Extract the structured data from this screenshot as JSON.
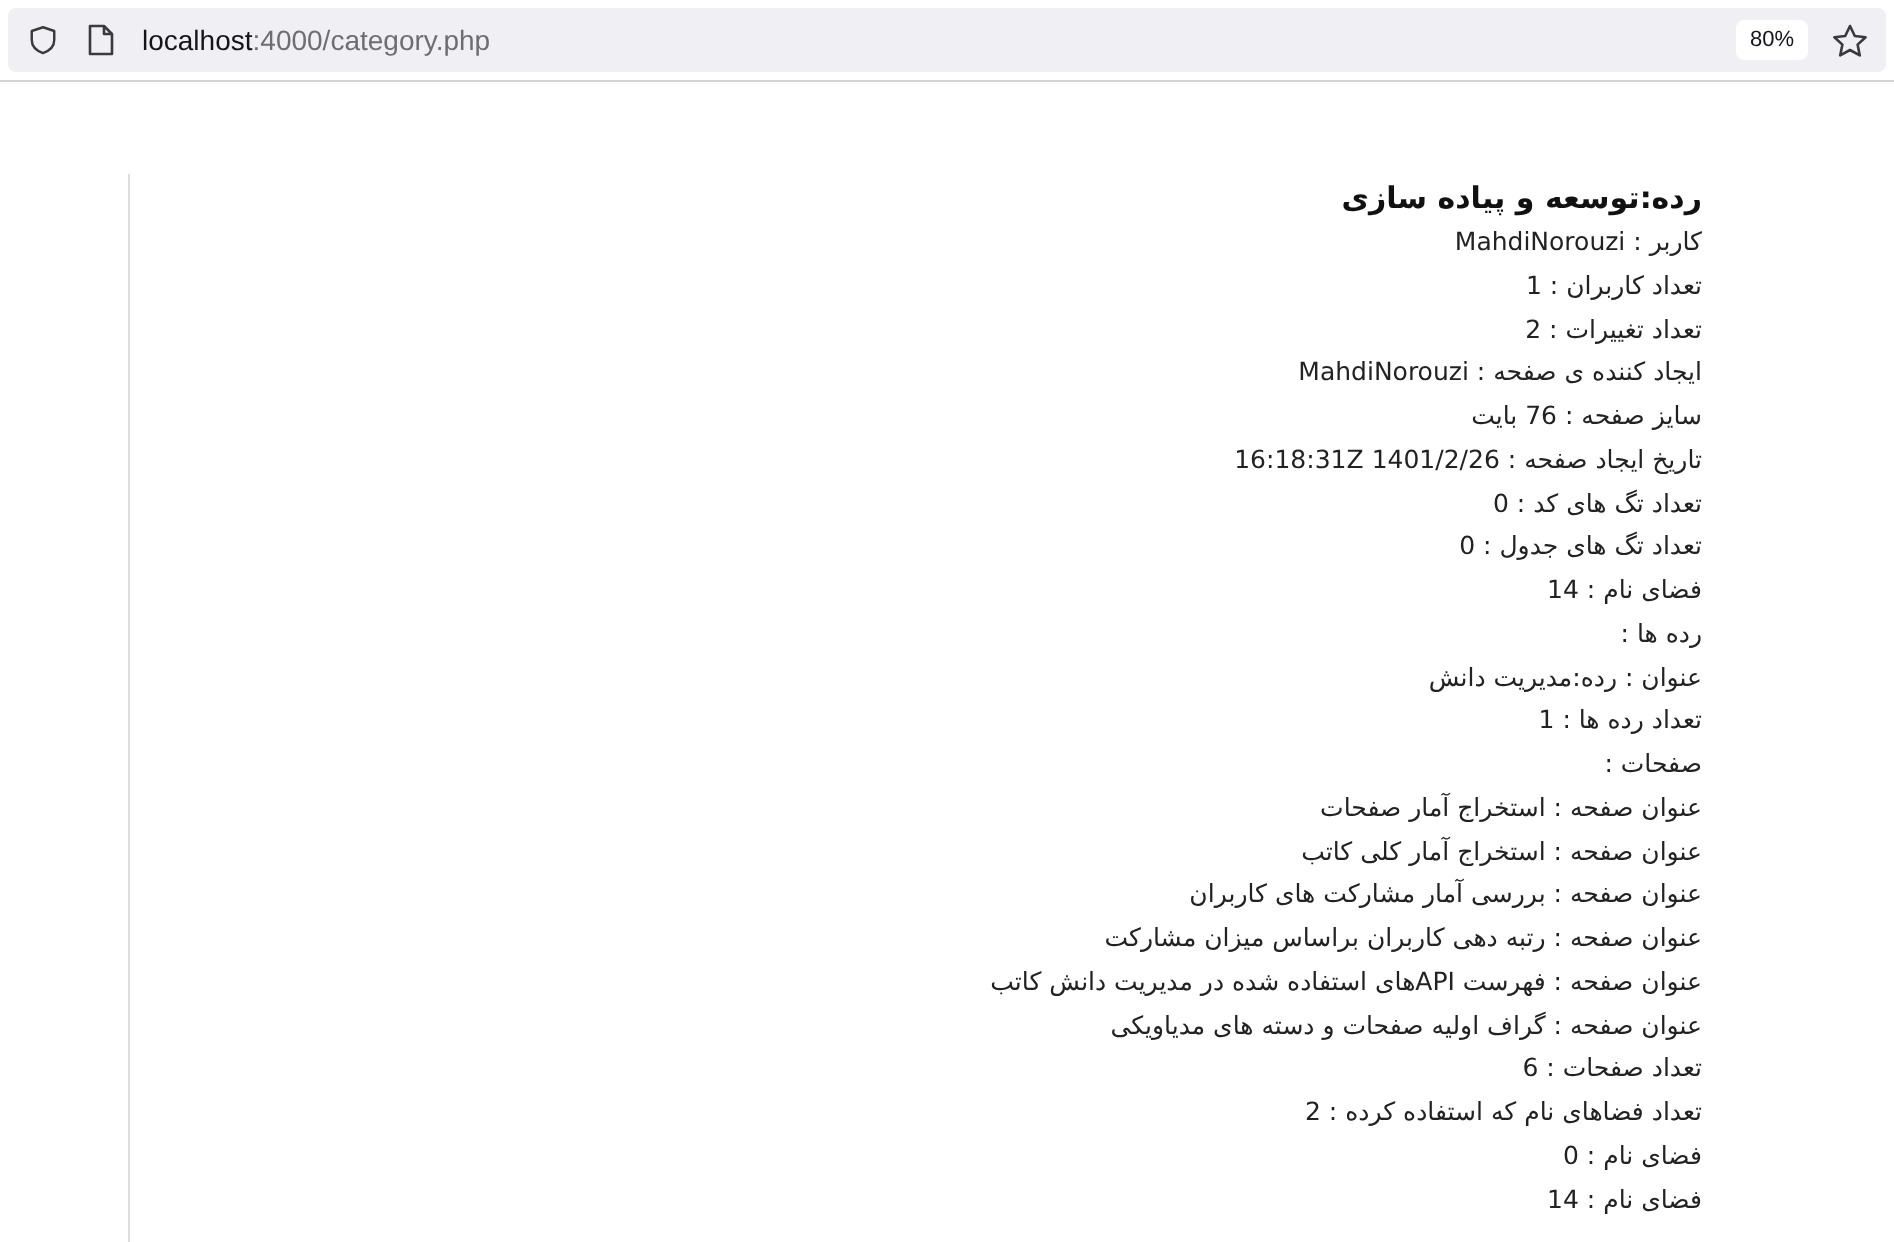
{
  "browser": {
    "url_host": "localhost",
    "url_rest": ":4000/category.php",
    "zoom": "80%"
  },
  "page": {
    "title": "رده:توسعه و پیاده سازی",
    "lines": [
      "کاربر : MahdiNorouzi",
      "تعداد کاربران : 1",
      "تعداد تغییرات : 2",
      "ایجاد کننده ی صفحه : MahdiNorouzi",
      "سایز صفحه : 76 بایت",
      "تاریخ ایجاد صفحه : 1401/2/26 16:18:31Z",
      "تعداد تگ های کد : 0",
      "تعداد تگ های جدول : 0",
      "فضای نام : 14",
      "رده ها :",
      "عنوان : رده:مدیریت دانش",
      "تعداد رده ها : 1",
      "صفحات :",
      "عنوان صفحه : استخراج آمار صفحات",
      "عنوان صفحه : استخراج آمار کلی کاتب",
      "عنوان صفحه : بررسی آمار مشارکت های کاربران",
      "عنوان صفحه : رتبه دهی کاربران براساس میزان مشارکت",
      "عنوان صفحه : فهرست APIهای استفاده شده در مدیریت دانش کاتب",
      "عنوان صفحه : گراف اولیه صفحات و دسته های مدیاویکی",
      "تعداد صفحات : 6",
      "تعداد فضاهای نام که استفاده کرده : 2",
      "فضای نام : 0",
      "فضای نام : 14"
    ]
  }
}
